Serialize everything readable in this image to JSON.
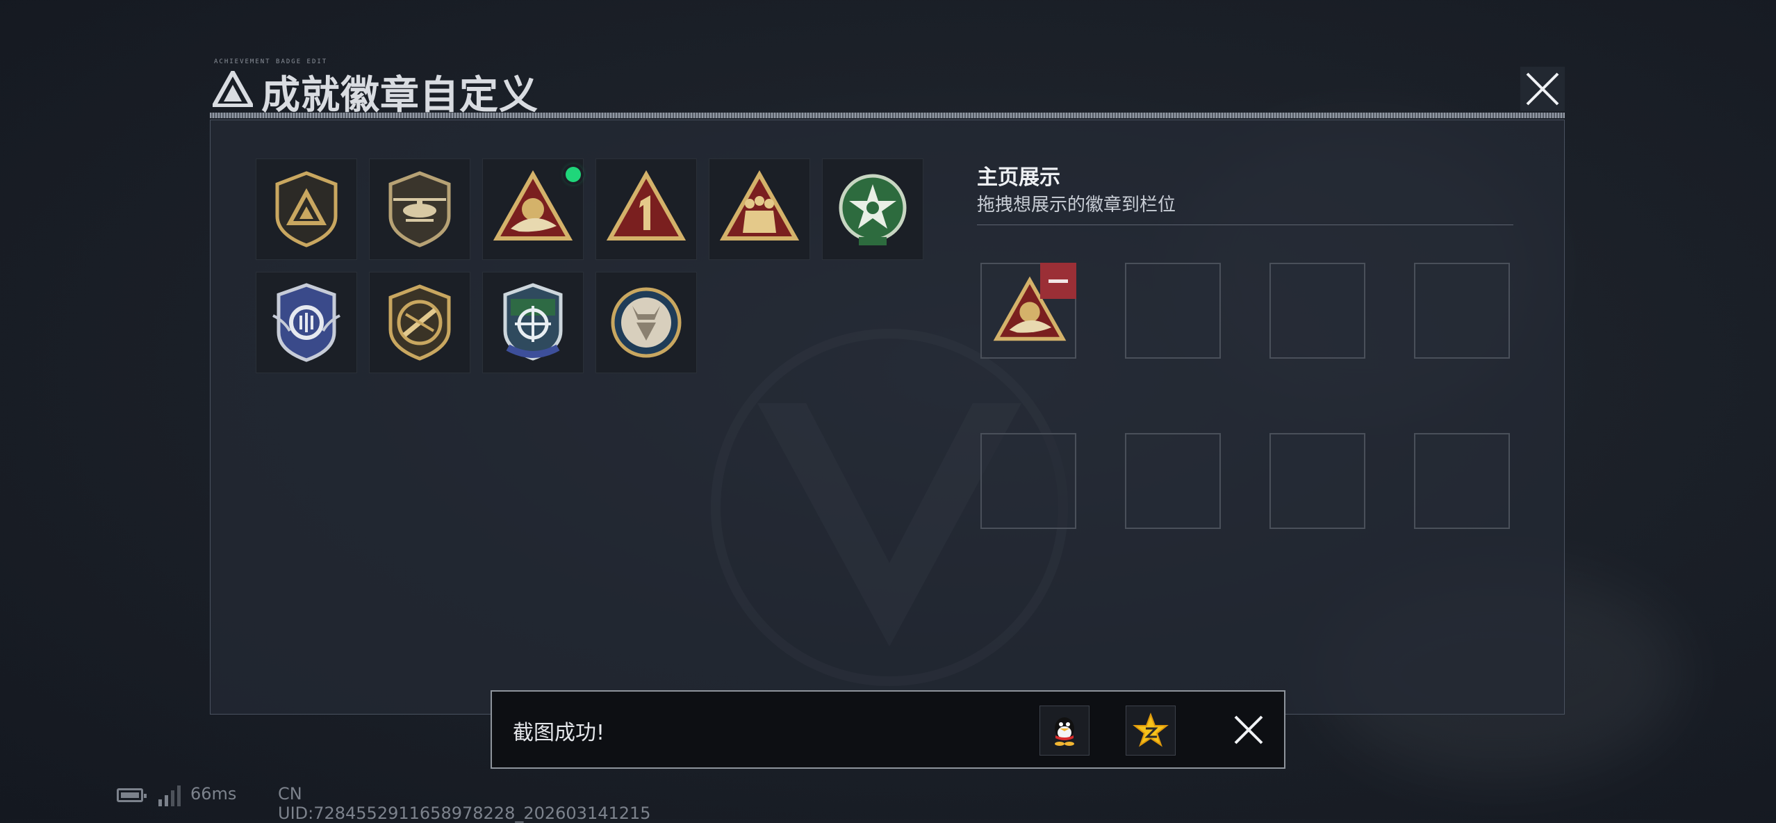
{
  "window": {
    "title": "成就徽章自定义",
    "title_tiny": "ACHIEVEMENT BADGE EDIT"
  },
  "badges": {
    "row1": [
      {
        "icon": "triangle-shield-badge-icon",
        "new": false
      },
      {
        "icon": "helicopter-badge-icon",
        "new": false
      },
      {
        "icon": "hand-triangle-badge-icon",
        "new": true
      },
      {
        "icon": "number-one-triangle-badge-icon",
        "new": false
      },
      {
        "icon": "soldiers-triangle-badge-icon",
        "new": false
      },
      {
        "icon": "green-star-badge-icon",
        "new": false
      }
    ],
    "row2": [
      {
        "icon": "blue-wings-badge-icon",
        "new": false
      },
      {
        "icon": "no-rifle-badge-icon",
        "new": false
      },
      {
        "icon": "crosshair-shield-badge-icon",
        "new": false
      },
      {
        "icon": "wolf-emblem-badge-icon",
        "new": false
      }
    ]
  },
  "showcase": {
    "title": "主页展示",
    "subtitle": "拖拽想展示的徽章到栏位",
    "slots_filled": 1,
    "slots_total": 8
  },
  "toast": {
    "message": "截图成功!",
    "share_targets": [
      "qq-icon",
      "qzone-icon"
    ]
  },
  "status_bar": {
    "ping": "66ms",
    "uid": "CN UID:7284552911658978228_202603141215"
  },
  "colors": {
    "accent_gold": "#c9a760",
    "badge_red": "#7a1f1f",
    "new_dot": "#1fd67a",
    "remove_red": "#9b2f36"
  }
}
